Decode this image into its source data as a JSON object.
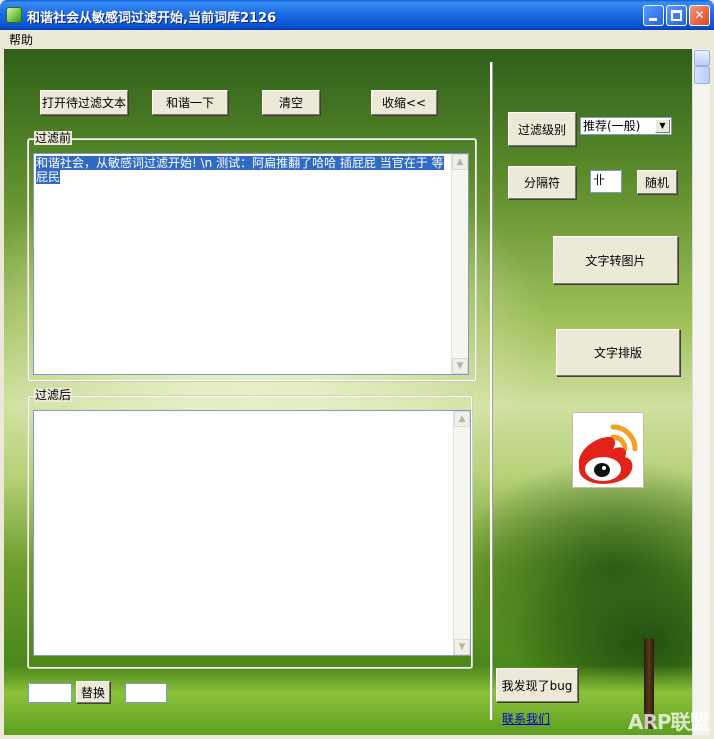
{
  "window": {
    "title": "和谐社会从敏感词过滤开始,当前词库2126",
    "minimize_glyph": "",
    "close_glyph": "✕"
  },
  "menu": {
    "help": "帮助"
  },
  "toolbar": {
    "open_file": "打开待过滤文本",
    "harmonize": "和谐一下",
    "clear": "清空",
    "collapse": "收缩<<"
  },
  "before": {
    "label": "过滤前",
    "text": "和谐社会，从敏感词过滤开始! \\n 测试：阿扁推翻了哈哈 插屁屁 当官在于 等屁民"
  },
  "after": {
    "label": "过滤后",
    "text": ""
  },
  "replace": {
    "left_value": "",
    "button": "替换",
    "right_value": ""
  },
  "settings": {
    "filter_level_label": "过滤级别",
    "filter_level_value": "推荐(一般)",
    "separator_label": "分隔符",
    "separator_value": "卝",
    "random_button": "随机",
    "text_to_image": "文字转图片",
    "text_layout": "文字排版",
    "bug_button": "我发现了bug",
    "contact_link": "联系我们"
  },
  "watermark": "ARP联盟",
  "colors": {
    "title_bar": "#0a52d2",
    "selection": "#316ac5",
    "weibo_red": "#e2231a",
    "weibo_orange": "#f5a021"
  },
  "icons": {
    "weibo": "weibo-icon",
    "app": "app-icon"
  }
}
